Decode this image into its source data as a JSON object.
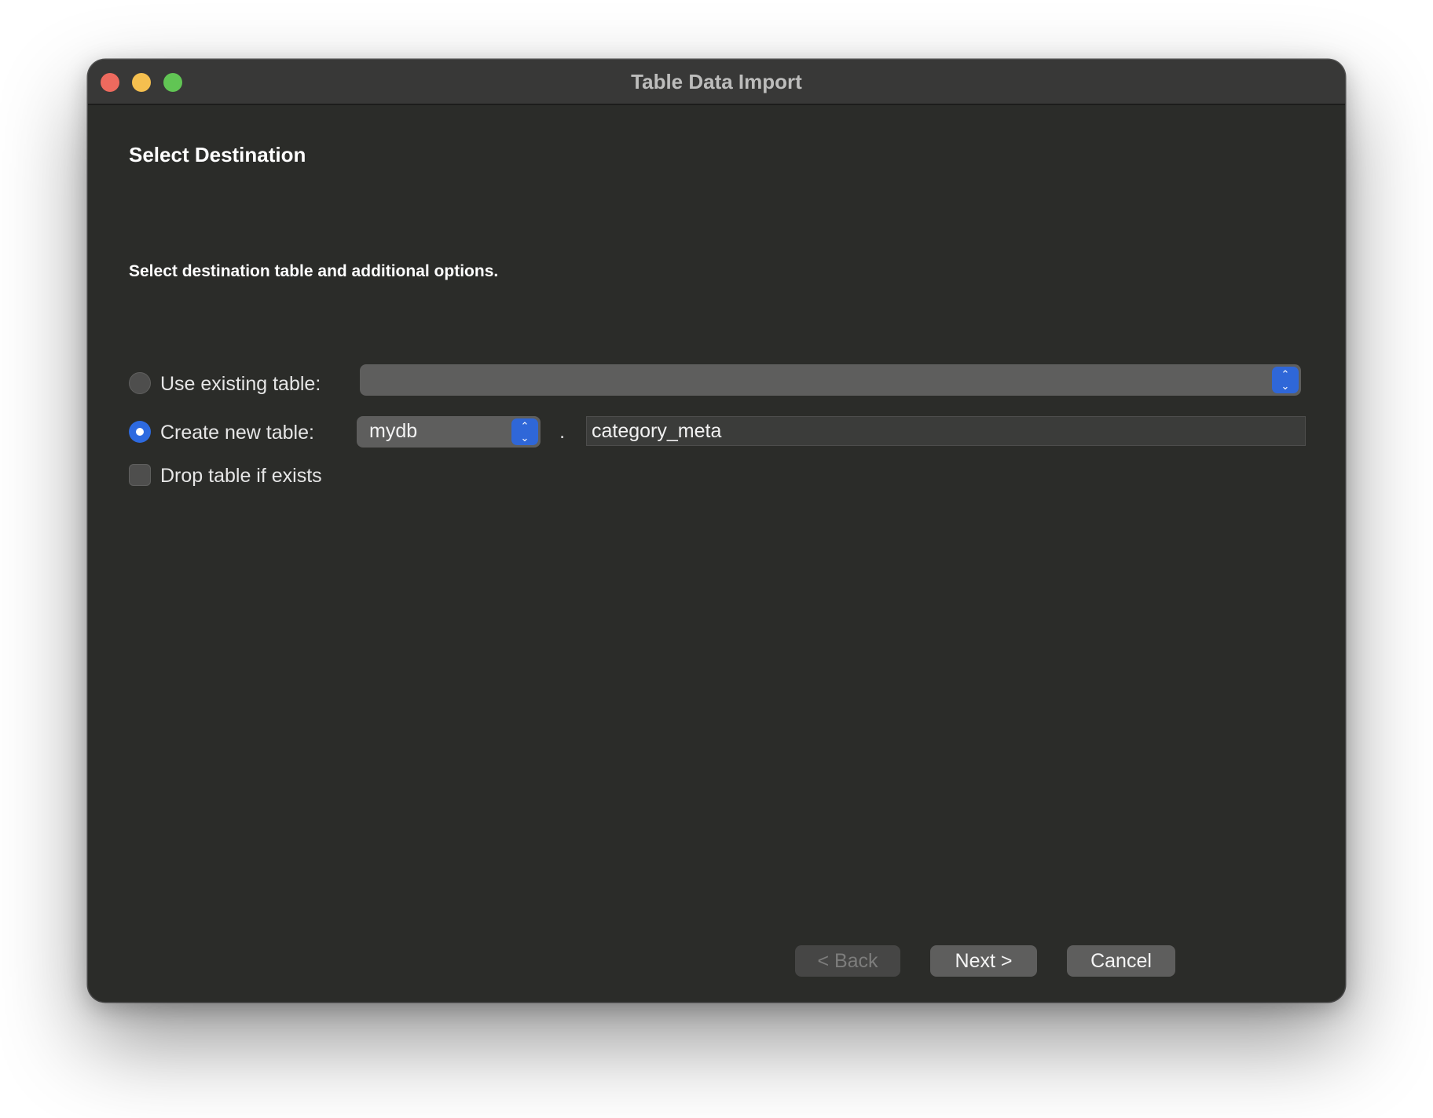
{
  "window": {
    "title": "Table Data Import"
  },
  "page": {
    "section_title": "Select Destination",
    "instruction": "Select destination table and additional options."
  },
  "options": {
    "use_existing": {
      "label": "Use existing table:",
      "selected": false,
      "combo_value": ""
    },
    "create_new": {
      "label": "Create new table:",
      "selected": true,
      "schema_value": "mydb",
      "separator": ".",
      "table_name": "category_meta"
    },
    "drop_if_exists": {
      "label": "Drop table if exists",
      "checked": false
    }
  },
  "buttons": {
    "back": {
      "label": "< Back",
      "enabled": false
    },
    "next": {
      "label": "Next >",
      "enabled": true
    },
    "cancel": {
      "label": "Cancel",
      "enabled": true
    }
  },
  "icons": {
    "stepper": "up-down-chevron-icon"
  },
  "colors": {
    "accent": "#2d6ae0",
    "window_bg": "#2b2c29",
    "titlebar_bg": "#383837",
    "traffic_close": "#ed6a5e",
    "traffic_minimize": "#f5bf4f",
    "traffic_zoom": "#61c554"
  }
}
